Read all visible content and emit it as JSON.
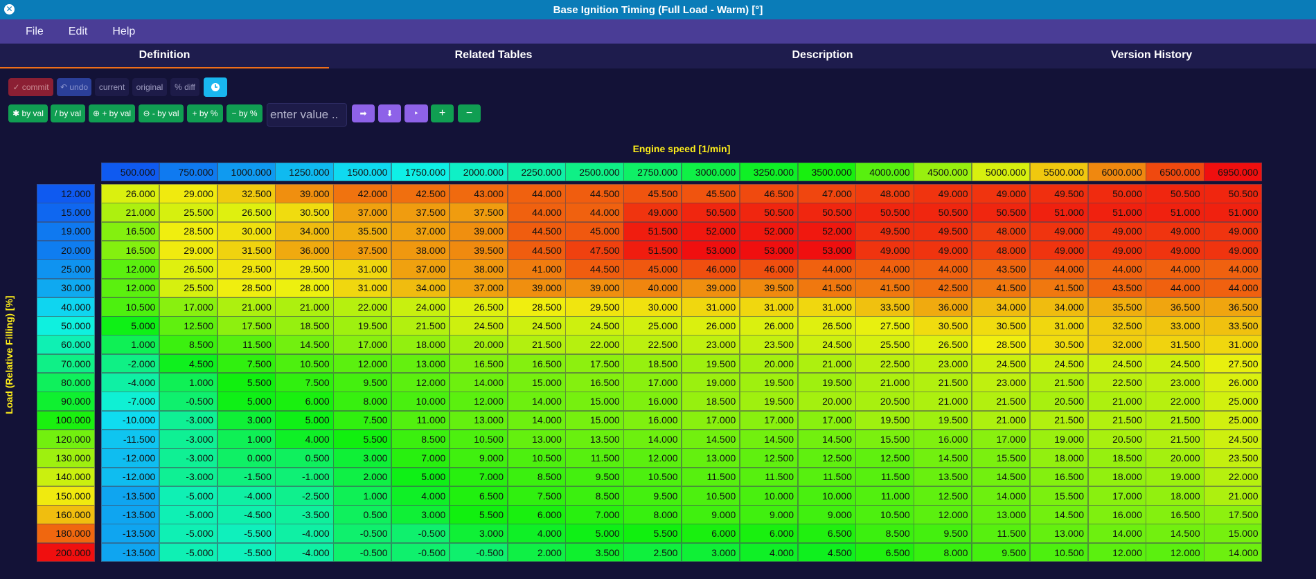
{
  "window": {
    "title": "Base Ignition Timing (Full Load - Warm) [°]",
    "close_icon": "close-icon"
  },
  "menu": [
    "File",
    "Edit",
    "Help"
  ],
  "tabs": [
    {
      "label": "Definition",
      "active": true
    },
    {
      "label": "Related Tables",
      "active": false
    },
    {
      "label": "Description",
      "active": false
    },
    {
      "label": "Version History",
      "active": false
    }
  ],
  "toolbar1": {
    "commit": "✓ commit",
    "undo": "↶ undo",
    "current": "current",
    "original": "original",
    "pct_diff": "% diff",
    "clock_icon": "clock-icon"
  },
  "toolbar2": {
    "mul": "✱ by val",
    "div": "/ by val",
    "add": "⊕ + by val",
    "sub": "⊖ - by val",
    "add_pct": "+ by %",
    "sub_pct": "− by %",
    "value_placeholder": "enter value ..",
    "fill_right": "➡",
    "fill_down": "⬇",
    "interp": "‣",
    "inc": "+",
    "dec": "−"
  },
  "table": {
    "x_title": "Engine speed [1/min]",
    "y_title": "Load (Relative Filling) [%]",
    "x_axis": [
      "500.000",
      "750.000",
      "1000.000",
      "1250.000",
      "1500.000",
      "1750.000",
      "2000.000",
      "2250.000",
      "2500.000",
      "2750.000",
      "3000.000",
      "3250.000",
      "3500.000",
      "4000.000",
      "4500.000",
      "5000.000",
      "5500.000",
      "6000.000",
      "6500.000",
      "6950.000"
    ],
    "y_axis": [
      "12.000",
      "15.000",
      "19.000",
      "20.000",
      "25.000",
      "30.000",
      "40.000",
      "50.000",
      "60.000",
      "70.000",
      "80.000",
      "90.000",
      "100.000",
      "120.000",
      "130.000",
      "140.000",
      "150.000",
      "160.000",
      "180.000",
      "200.000"
    ],
    "rows": [
      [
        "26.000",
        "29.000",
        "32.500",
        "39.000",
        "42.000",
        "42.500",
        "43.000",
        "44.000",
        "44.500",
        "45.500",
        "45.500",
        "46.500",
        "47.000",
        "48.000",
        "49.000",
        "49.000",
        "49.500",
        "50.000",
        "50.500",
        "50.500"
      ],
      [
        "21.000",
        "25.500",
        "26.500",
        "30.500",
        "37.000",
        "37.500",
        "37.500",
        "44.000",
        "44.000",
        "49.000",
        "50.500",
        "50.500",
        "50.500",
        "50.500",
        "50.500",
        "50.500",
        "51.000",
        "51.000",
        "51.000",
        "51.000"
      ],
      [
        "16.500",
        "28.500",
        "30.000",
        "34.000",
        "35.500",
        "37.000",
        "39.000",
        "44.500",
        "45.000",
        "51.500",
        "52.000",
        "52.000",
        "52.000",
        "49.500",
        "49.500",
        "48.000",
        "49.000",
        "49.000",
        "49.000",
        "49.000"
      ],
      [
        "16.500",
        "29.000",
        "31.500",
        "36.000",
        "37.500",
        "38.000",
        "39.500",
        "44.500",
        "47.500",
        "51.500",
        "53.000",
        "53.000",
        "53.000",
        "49.000",
        "49.000",
        "48.000",
        "49.000",
        "49.000",
        "49.000",
        "49.000"
      ],
      [
        "12.000",
        "26.500",
        "29.500",
        "29.500",
        "31.000",
        "37.000",
        "38.000",
        "41.000",
        "44.500",
        "45.000",
        "46.000",
        "46.000",
        "44.000",
        "44.000",
        "44.000",
        "43.500",
        "44.000",
        "44.000",
        "44.000",
        "44.000"
      ],
      [
        "12.000",
        "25.500",
        "28.500",
        "28.000",
        "31.000",
        "34.000",
        "37.000",
        "39.000",
        "39.000",
        "40.000",
        "39.000",
        "39.500",
        "41.500",
        "41.500",
        "42.500",
        "41.500",
        "41.500",
        "43.500",
        "44.000",
        "44.000"
      ],
      [
        "10.500",
        "17.000",
        "21.000",
        "21.000",
        "22.000",
        "24.000",
        "26.500",
        "28.500",
        "29.500",
        "30.000",
        "31.000",
        "31.000",
        "31.000",
        "33.500",
        "36.000",
        "34.000",
        "34.000",
        "35.500",
        "36.500",
        "36.500"
      ],
      [
        "5.000",
        "12.500",
        "17.500",
        "18.500",
        "19.500",
        "21.500",
        "24.500",
        "24.500",
        "24.500",
        "25.000",
        "26.000",
        "26.000",
        "26.500",
        "27.500",
        "30.500",
        "30.500",
        "31.000",
        "32.500",
        "33.000",
        "33.500"
      ],
      [
        "1.000",
        "8.500",
        "11.500",
        "14.500",
        "17.000",
        "18.000",
        "20.000",
        "21.500",
        "22.000",
        "22.500",
        "23.000",
        "23.500",
        "24.500",
        "25.500",
        "26.500",
        "28.500",
        "30.500",
        "32.000",
        "31.500",
        "31.000"
      ],
      [
        "-2.000",
        "4.500",
        "7.500",
        "10.500",
        "12.000",
        "13.000",
        "16.500",
        "16.500",
        "17.500",
        "18.500",
        "19.500",
        "20.000",
        "21.000",
        "22.500",
        "23.000",
        "24.500",
        "24.500",
        "24.500",
        "24.500",
        "27.500"
      ],
      [
        "-4.000",
        "1.000",
        "5.500",
        "7.500",
        "9.500",
        "12.000",
        "14.000",
        "15.000",
        "16.500",
        "17.000",
        "19.000",
        "19.500",
        "19.500",
        "21.000",
        "21.500",
        "23.000",
        "21.500",
        "22.500",
        "23.000",
        "26.000"
      ],
      [
        "-7.000",
        "-0.500",
        "5.000",
        "6.000",
        "8.000",
        "10.000",
        "12.000",
        "14.000",
        "15.000",
        "16.000",
        "18.500",
        "19.500",
        "20.000",
        "20.500",
        "21.000",
        "21.500",
        "20.500",
        "21.000",
        "22.000",
        "25.000"
      ],
      [
        "-10.000",
        "-3.000",
        "3.000",
        "5.000",
        "7.500",
        "11.000",
        "13.000",
        "14.000",
        "15.000",
        "16.000",
        "17.000",
        "17.000",
        "17.000",
        "19.500",
        "19.500",
        "21.000",
        "21.500",
        "21.500",
        "21.500",
        "25.000"
      ],
      [
        "-11.500",
        "-3.000",
        "1.000",
        "4.000",
        "5.500",
        "8.500",
        "10.500",
        "13.000",
        "13.500",
        "14.000",
        "14.500",
        "14.500",
        "14.500",
        "15.500",
        "16.000",
        "17.000",
        "19.000",
        "20.500",
        "21.500",
        "24.500"
      ],
      [
        "-12.000",
        "-3.000",
        "0.000",
        "0.500",
        "3.000",
        "7.000",
        "9.000",
        "10.500",
        "11.500",
        "12.000",
        "13.000",
        "12.500",
        "12.500",
        "12.500",
        "14.500",
        "15.500",
        "18.000",
        "18.500",
        "20.000",
        "23.500"
      ],
      [
        "-12.000",
        "-3.000",
        "-1.500",
        "-1.000",
        "2.000",
        "5.000",
        "7.000",
        "8.500",
        "9.500",
        "10.500",
        "11.500",
        "11.500",
        "11.500",
        "11.500",
        "13.500",
        "14.500",
        "16.500",
        "18.000",
        "19.000",
        "22.000"
      ],
      [
        "-13.500",
        "-5.000",
        "-4.000",
        "-2.500",
        "1.000",
        "4.000",
        "6.500",
        "7.500",
        "8.500",
        "9.500",
        "10.500",
        "10.000",
        "10.000",
        "11.000",
        "12.500",
        "14.000",
        "15.500",
        "17.000",
        "18.000",
        "21.000"
      ],
      [
        "-13.500",
        "-5.000",
        "-4.500",
        "-3.500",
        "0.500",
        "3.000",
        "5.500",
        "6.000",
        "7.000",
        "8.000",
        "9.000",
        "9.000",
        "9.000",
        "10.500",
        "12.000",
        "13.000",
        "14.500",
        "16.000",
        "16.500",
        "17.500"
      ],
      [
        "-13.500",
        "-5.000",
        "-5.500",
        "-4.000",
        "-0.500",
        "-0.500",
        "3.000",
        "4.000",
        "5.000",
        "5.500",
        "6.000",
        "6.000",
        "6.500",
        "8.500",
        "9.500",
        "11.500",
        "13.000",
        "14.000",
        "14.500",
        "15.000"
      ],
      [
        "-13.500",
        "-5.000",
        "-5.500",
        "-4.000",
        "-0.500",
        "-0.500",
        "-0.500",
        "2.000",
        "3.500",
        "2.500",
        "3.000",
        "4.000",
        "4.500",
        "6.500",
        "8.000",
        "9.500",
        "10.500",
        "12.000",
        "12.000",
        "14.000"
      ]
    ]
  }
}
